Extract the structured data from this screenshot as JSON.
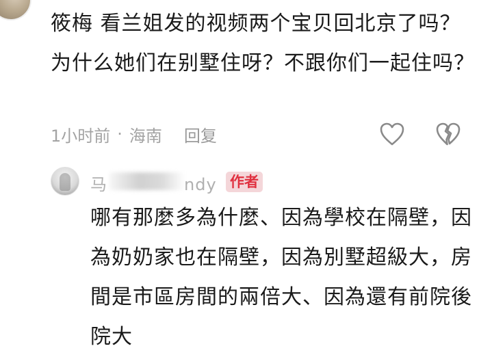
{
  "comment": {
    "text": "筱梅 看兰姐发的视频两个宝贝回北京了吗？为什么她们在别墅住呀？不跟你们一起住吗？",
    "time": "1小时前",
    "separator": "·",
    "location": "海南",
    "reply_label": "回复",
    "like_icon": "heart-outline-icon",
    "dislike_icon": "broken-heart-icon"
  },
  "reply": {
    "author": "马██ndy",
    "author_prefix": "马",
    "author_suffix": "ndy",
    "badge": "作者",
    "text": "哪有那麼多為什麼、因為學校在隔壁，因為奶奶家也在隔壁，因為別墅超級大，房間是市區房間的兩倍大、因為還有前院後院大"
  },
  "colors": {
    "badge_bg": "#f4d6d9",
    "badge_text": "#e0303f",
    "meta_text": "#a3a3a3"
  }
}
